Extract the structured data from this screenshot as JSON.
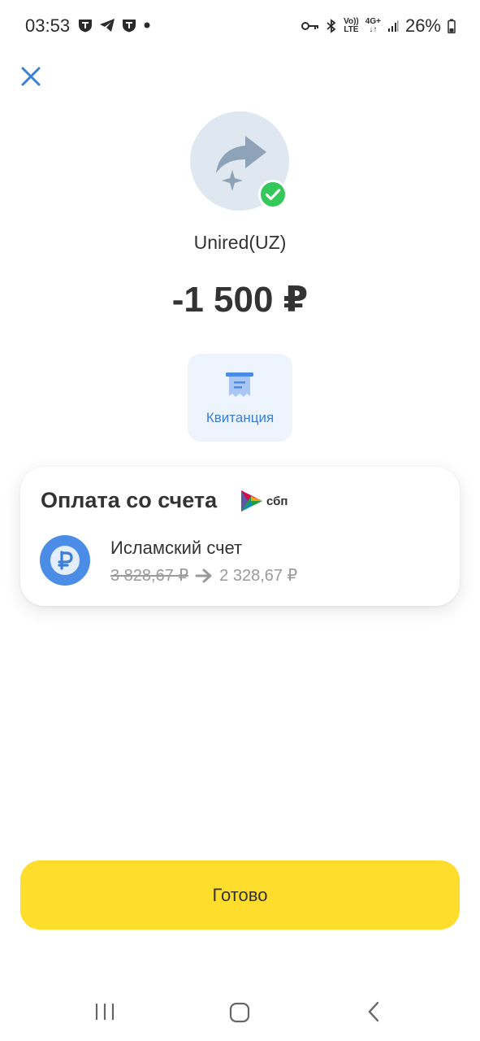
{
  "status_bar": {
    "time": "03:53",
    "volte_top": "Vo))",
    "volte_bottom": "LTE",
    "network": "4G+",
    "battery": "26%"
  },
  "header": {
    "close_icon": "close-icon"
  },
  "transaction": {
    "recipient": "Unired(UZ)",
    "amount": "-1 500 ₽",
    "avatar_icon": "transfer-arrow-icon",
    "status_icon": "check-circle-icon",
    "status_color": "#34c759"
  },
  "receipt": {
    "label": "Квитанция",
    "icon": "receipt-icon"
  },
  "payment_card": {
    "title": "Оплата со счета",
    "sbp_label": "сбп",
    "account_name": "Исламский счет",
    "old_balance": "3 828,67 ₽",
    "new_balance": "2 328,67 ₽",
    "account_icon": "ruble-icon"
  },
  "footer": {
    "done_label": "Готово"
  },
  "colors": {
    "accent_yellow": "#ffdd2d",
    "accent_blue": "#3b7ed6"
  }
}
